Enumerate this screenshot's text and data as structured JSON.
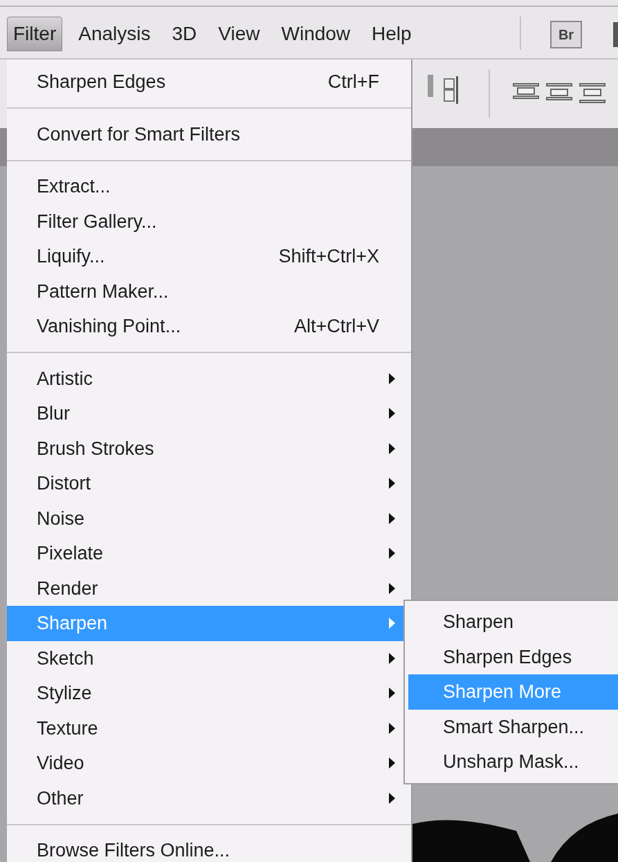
{
  "menu_bar": [
    {
      "label": "Filter",
      "selected": true
    },
    {
      "label": "Analysis",
      "selected": false
    },
    {
      "label": "3D",
      "selected": false
    },
    {
      "label": "View",
      "selected": false
    },
    {
      "label": "Window",
      "selected": false
    },
    {
      "label": "Help",
      "selected": false
    }
  ],
  "bridge_button": {
    "label": "Br"
  },
  "filter_menu": {
    "items": [
      {
        "kind": "item",
        "label": "Sharpen Edges",
        "shortcut": "Ctrl+F",
        "has_submenu": false,
        "selected": false
      },
      {
        "kind": "separator"
      },
      {
        "kind": "item",
        "label": "Convert for Smart Filters",
        "has_submenu": false,
        "selected": false
      },
      {
        "kind": "separator"
      },
      {
        "kind": "item",
        "label": "Extract...",
        "has_submenu": false,
        "selected": false
      },
      {
        "kind": "item",
        "label": "Filter Gallery...",
        "has_submenu": false,
        "selected": false
      },
      {
        "kind": "item",
        "label": "Liquify...",
        "shortcut": "Shift+Ctrl+X",
        "has_submenu": false,
        "selected": false
      },
      {
        "kind": "item",
        "label": "Pattern Maker...",
        "has_submenu": false,
        "selected": false
      },
      {
        "kind": "item",
        "label": "Vanishing Point...",
        "shortcut": "Alt+Ctrl+V",
        "has_submenu": false,
        "selected": false
      },
      {
        "kind": "separator"
      },
      {
        "kind": "item",
        "label": "Artistic",
        "has_submenu": true,
        "selected": false
      },
      {
        "kind": "item",
        "label": "Blur",
        "has_submenu": true,
        "selected": false
      },
      {
        "kind": "item",
        "label": "Brush Strokes",
        "has_submenu": true,
        "selected": false
      },
      {
        "kind": "item",
        "label": "Distort",
        "has_submenu": true,
        "selected": false
      },
      {
        "kind": "item",
        "label": "Noise",
        "has_submenu": true,
        "selected": false
      },
      {
        "kind": "item",
        "label": "Pixelate",
        "has_submenu": true,
        "selected": false
      },
      {
        "kind": "item",
        "label": "Render",
        "has_submenu": true,
        "selected": false
      },
      {
        "kind": "item",
        "label": "Sharpen",
        "has_submenu": true,
        "selected": true
      },
      {
        "kind": "item",
        "label": "Sketch",
        "has_submenu": true,
        "selected": false
      },
      {
        "kind": "item",
        "label": "Stylize",
        "has_submenu": true,
        "selected": false
      },
      {
        "kind": "item",
        "label": "Texture",
        "has_submenu": true,
        "selected": false
      },
      {
        "kind": "item",
        "label": "Video",
        "has_submenu": true,
        "selected": false
      },
      {
        "kind": "item",
        "label": "Other",
        "has_submenu": true,
        "selected": false
      },
      {
        "kind": "separator"
      },
      {
        "kind": "item",
        "label": "Browse Filters Online...",
        "has_submenu": false,
        "selected": false
      }
    ]
  },
  "sharpen_submenu": {
    "items": [
      {
        "label": "Sharpen",
        "selected": false
      },
      {
        "label": "Sharpen Edges",
        "selected": false
      },
      {
        "label": "Sharpen More",
        "selected": true
      },
      {
        "label": "Smart Sharpen...",
        "selected": false
      },
      {
        "label": "Unsharp Mask...",
        "selected": false
      }
    ]
  }
}
